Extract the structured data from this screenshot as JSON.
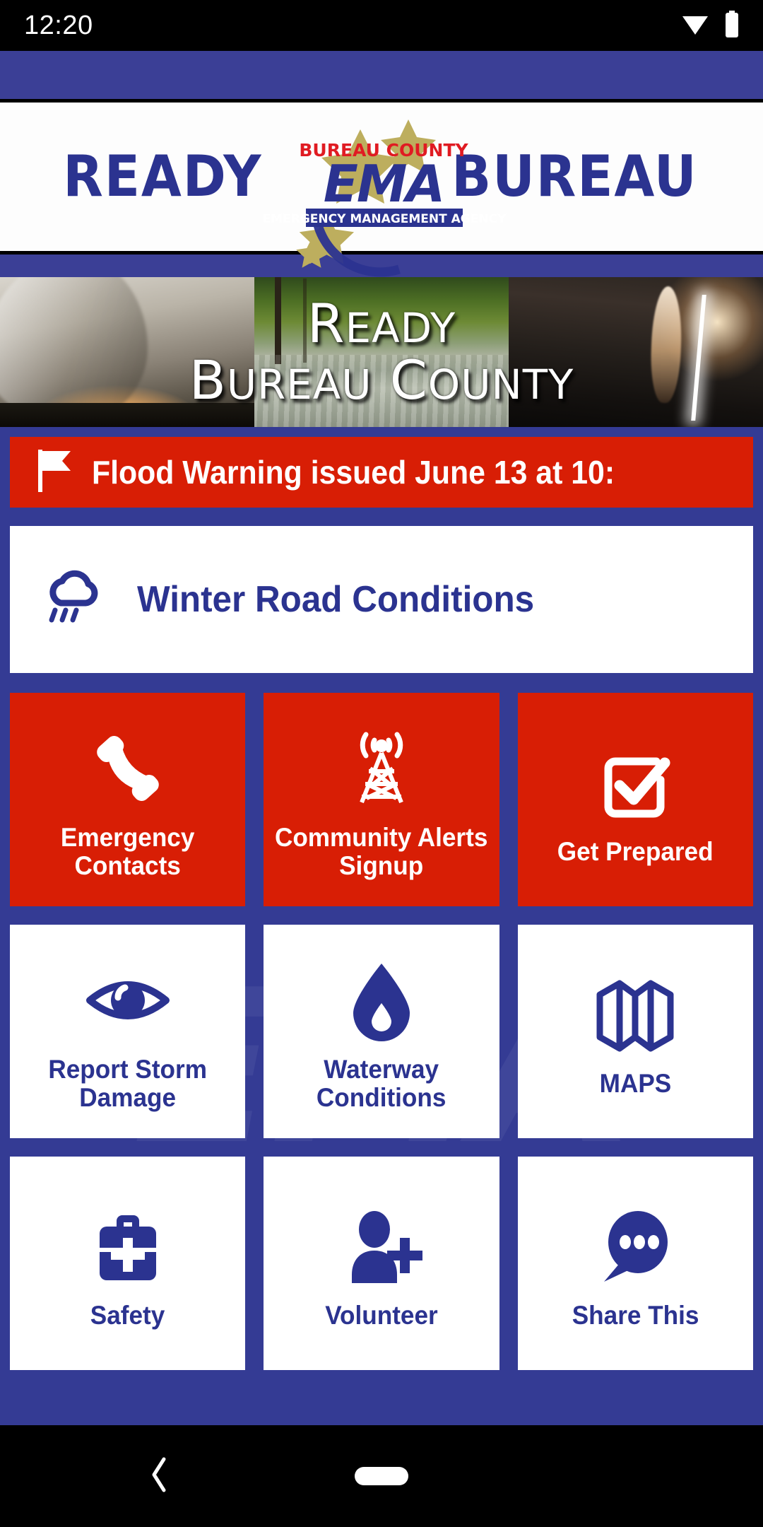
{
  "status_bar": {
    "time": "12:20",
    "icons": [
      "wifi-icon",
      "battery-icon"
    ]
  },
  "header": {
    "word_left": "READY",
    "word_right": "BUREAU",
    "logo": {
      "top_line_1": "BUREAU",
      "top_line_2": "COUNTY",
      "acronym": "EMA",
      "caption": "EMERGENCY MANAGEMENT AGENCY",
      "star_color": "#BDAE5E",
      "blue": "#2B3390",
      "red": "#E01B22"
    }
  },
  "hero": {
    "line1": "READY",
    "line2": "BUREAU COUNTY",
    "panels": [
      "tornado-photo",
      "flood-photo",
      "lightning-photo"
    ]
  },
  "alert": {
    "icon": "flag-icon",
    "text": "Flood Warning issued June 13 at 10:",
    "background": "#D81E05"
  },
  "info_card": {
    "icon": "rain-cloud-icon",
    "text": "Winter Road Conditions",
    "color": "#2B3390"
  },
  "tiles": [
    {
      "label": "Emergency Contacts",
      "icon": "phone-icon",
      "style": "red"
    },
    {
      "label": "Community Alerts Signup",
      "icon": "radio-tower-icon",
      "style": "red"
    },
    {
      "label": "Get Prepared",
      "icon": "checkbox-check-icon",
      "style": "red"
    },
    {
      "label": "Report Storm Damage",
      "icon": "eye-icon",
      "style": "white"
    },
    {
      "label": "Waterway Conditions",
      "icon": "water-drop-icon",
      "style": "white"
    },
    {
      "label": "MAPS",
      "icon": "folded-map-icon",
      "style": "white"
    },
    {
      "label": "Safety",
      "icon": "first-aid-kit-icon",
      "style": "white"
    },
    {
      "label": "Volunteer",
      "icon": "person-add-icon",
      "style": "white"
    },
    {
      "label": "Share This",
      "icon": "speech-bubble-icon",
      "style": "white"
    }
  ],
  "watermark": "EMA",
  "nav_bar": {
    "back": "back-chevron-icon",
    "home": "home-pill-icon"
  },
  "colors": {
    "brand_blue": "#343B94",
    "deep_blue": "#2B3390",
    "alert_red": "#D81E05",
    "white": "#FFFFFF"
  }
}
